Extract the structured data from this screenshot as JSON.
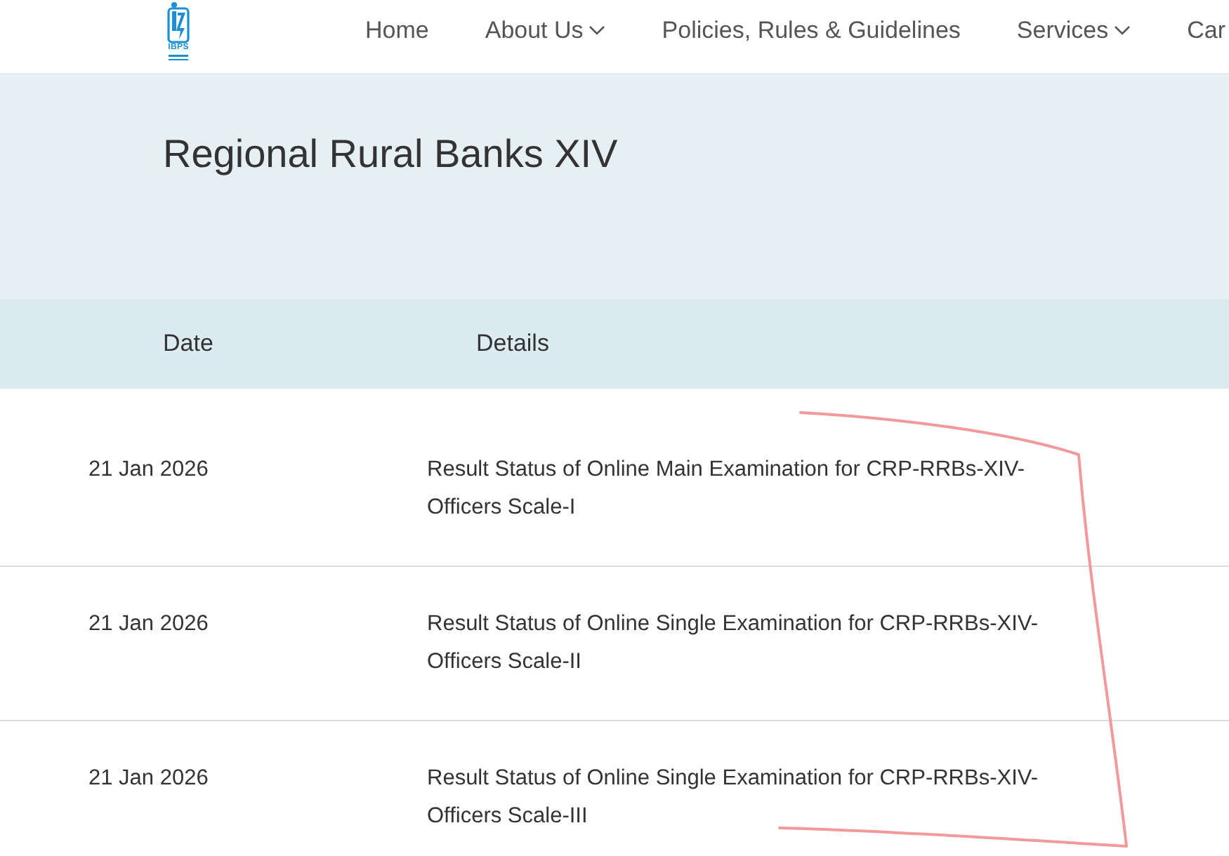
{
  "header": {
    "logo": {
      "text": "IBPS"
    },
    "nav": [
      {
        "label": "Home",
        "dropdown": false
      },
      {
        "label": "About Us",
        "dropdown": true
      },
      {
        "label": "Policies, Rules & Guidelines",
        "dropdown": false
      },
      {
        "label": "Services",
        "dropdown": true
      },
      {
        "label": "Car",
        "dropdown": false
      }
    ]
  },
  "page_title": "Regional Rural Banks XIV",
  "table": {
    "columns": [
      "Date",
      "Details"
    ],
    "rows": [
      {
        "date": "21 Jan 2026",
        "details": "Result Status of Online Main Examination for CRP-RRBs-XIV-Officers Scale-I"
      },
      {
        "date": "21 Jan 2026",
        "details": "Result Status of Online Single Examination for CRP-RRBs-XIV-Officers Scale-II"
      },
      {
        "date": "21 Jan 2026",
        "details": "Result Status of Online Single Examination for CRP-RRBs-XIV-Officers Scale-III"
      }
    ]
  }
}
